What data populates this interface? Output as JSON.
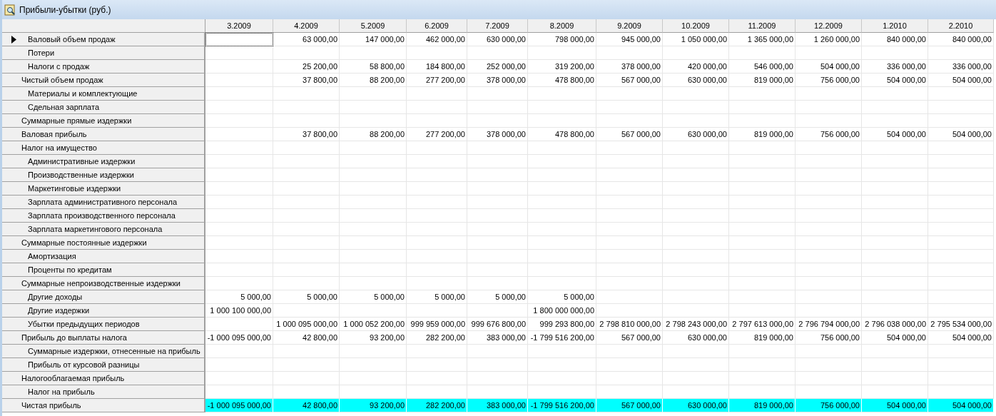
{
  "window": {
    "title": "Прибыли-убытки (руб.)"
  },
  "table": {
    "columns": [
      "3.2009",
      "4.2009",
      "5.2009",
      "6.2009",
      "7.2009",
      "8.2009",
      "9.2009",
      "10.2009",
      "11.2009",
      "12.2009",
      "1.2010",
      "2.2010"
    ],
    "rows": [
      {
        "label": "Валовый объем продаж",
        "kind": "item",
        "current": true,
        "highlighted": false,
        "cells": [
          null,
          "63 000,00",
          "147 000,00",
          "462 000,00",
          "630 000,00",
          "798 000,00",
          "945 000,00",
          "1 050 000,00",
          "1 365 000,00",
          "1 260 000,00",
          "840 000,00",
          "840 000,00"
        ]
      },
      {
        "label": "Потери",
        "kind": "item",
        "current": false,
        "highlighted": false,
        "cells": [
          null,
          null,
          null,
          null,
          null,
          null,
          null,
          null,
          null,
          null,
          null,
          null
        ]
      },
      {
        "label": "Налоги с продаж",
        "kind": "item",
        "current": false,
        "highlighted": false,
        "cells": [
          null,
          "25 200,00",
          "58 800,00",
          "184 800,00",
          "252 000,00",
          "319 200,00",
          "378 000,00",
          "420 000,00",
          "546 000,00",
          "504 000,00",
          "336 000,00",
          "336 000,00"
        ]
      },
      {
        "label": "Чистый объем продаж",
        "kind": "total",
        "current": false,
        "highlighted": false,
        "cells": [
          null,
          "37 800,00",
          "88 200,00",
          "277 200,00",
          "378 000,00",
          "478 800,00",
          "567 000,00",
          "630 000,00",
          "819 000,00",
          "756 000,00",
          "504 000,00",
          "504 000,00"
        ]
      },
      {
        "label": "Материалы и комплектующие",
        "kind": "item",
        "current": false,
        "highlighted": false,
        "cells": [
          null,
          null,
          null,
          null,
          null,
          null,
          null,
          null,
          null,
          null,
          null,
          null
        ]
      },
      {
        "label": "Сдельная зарплата",
        "kind": "item",
        "current": false,
        "highlighted": false,
        "cells": [
          null,
          null,
          null,
          null,
          null,
          null,
          null,
          null,
          null,
          null,
          null,
          null
        ]
      },
      {
        "label": "Суммарные прямые издержки",
        "kind": "total",
        "current": false,
        "highlighted": false,
        "cells": [
          null,
          null,
          null,
          null,
          null,
          null,
          null,
          null,
          null,
          null,
          null,
          null
        ]
      },
      {
        "label": "Валовая прибыль",
        "kind": "total",
        "current": false,
        "highlighted": false,
        "cells": [
          null,
          "37 800,00",
          "88 200,00",
          "277 200,00",
          "378 000,00",
          "478 800,00",
          "567 000,00",
          "630 000,00",
          "819 000,00",
          "756 000,00",
          "504 000,00",
          "504 000,00"
        ]
      },
      {
        "label": "Налог на имущество",
        "kind": "total",
        "current": false,
        "highlighted": false,
        "cells": [
          null,
          null,
          null,
          null,
          null,
          null,
          null,
          null,
          null,
          null,
          null,
          null
        ]
      },
      {
        "label": "Административные издержки",
        "kind": "item",
        "current": false,
        "highlighted": false,
        "cells": [
          null,
          null,
          null,
          null,
          null,
          null,
          null,
          null,
          null,
          null,
          null,
          null
        ]
      },
      {
        "label": "Производственные издержки",
        "kind": "item",
        "current": false,
        "highlighted": false,
        "cells": [
          null,
          null,
          null,
          null,
          null,
          null,
          null,
          null,
          null,
          null,
          null,
          null
        ]
      },
      {
        "label": "Маркетинговые издержки",
        "kind": "item",
        "current": false,
        "highlighted": false,
        "cells": [
          null,
          null,
          null,
          null,
          null,
          null,
          null,
          null,
          null,
          null,
          null,
          null
        ]
      },
      {
        "label": "Зарплата административного персонала",
        "kind": "item",
        "current": false,
        "highlighted": false,
        "cells": [
          null,
          null,
          null,
          null,
          null,
          null,
          null,
          null,
          null,
          null,
          null,
          null
        ]
      },
      {
        "label": "Зарплата производственного персонала",
        "kind": "item",
        "current": false,
        "highlighted": false,
        "cells": [
          null,
          null,
          null,
          null,
          null,
          null,
          null,
          null,
          null,
          null,
          null,
          null
        ]
      },
      {
        "label": "Зарплата маркетингового персонала",
        "kind": "item",
        "current": false,
        "highlighted": false,
        "cells": [
          null,
          null,
          null,
          null,
          null,
          null,
          null,
          null,
          null,
          null,
          null,
          null
        ]
      },
      {
        "label": "Суммарные постоянные издержки",
        "kind": "total",
        "current": false,
        "highlighted": false,
        "cells": [
          null,
          null,
          null,
          null,
          null,
          null,
          null,
          null,
          null,
          null,
          null,
          null
        ]
      },
      {
        "label": "Амортизация",
        "kind": "item",
        "current": false,
        "highlighted": false,
        "cells": [
          null,
          null,
          null,
          null,
          null,
          null,
          null,
          null,
          null,
          null,
          null,
          null
        ]
      },
      {
        "label": "Проценты по кредитам",
        "kind": "item",
        "current": false,
        "highlighted": false,
        "cells": [
          null,
          null,
          null,
          null,
          null,
          null,
          null,
          null,
          null,
          null,
          null,
          null
        ]
      },
      {
        "label": "Суммарные непроизводственные издержки",
        "kind": "total",
        "current": false,
        "highlighted": false,
        "cells": [
          null,
          null,
          null,
          null,
          null,
          null,
          null,
          null,
          null,
          null,
          null,
          null
        ]
      },
      {
        "label": "Другие доходы",
        "kind": "item",
        "current": false,
        "highlighted": false,
        "cells": [
          "5 000,00",
          "5 000,00",
          "5 000,00",
          "5 000,00",
          "5 000,00",
          "5 000,00",
          null,
          null,
          null,
          null,
          null,
          null
        ]
      },
      {
        "label": "Другие издержки",
        "kind": "item",
        "current": false,
        "highlighted": false,
        "cells": [
          "1 000 100 000,00",
          null,
          null,
          null,
          null,
          "1 800 000 000,00",
          null,
          null,
          null,
          null,
          null,
          null
        ]
      },
      {
        "label": "Убытки предыдущих периодов",
        "kind": "item",
        "current": false,
        "highlighted": false,
        "cells": [
          null,
          "1 000 095 000,00",
          "1 000 052 200,00",
          "999 959 000,00",
          "999 676 800,00",
          "999 293 800,00",
          "2 798 810 000,00",
          "2 798 243 000,00",
          "2 797 613 000,00",
          "2 796 794 000,00",
          "2 796 038 000,00",
          "2 795 534 000,00"
        ]
      },
      {
        "label": "Прибыль до выплаты налога",
        "kind": "total",
        "current": false,
        "highlighted": false,
        "cells": [
          "-1 000 095 000,00",
          "42 800,00",
          "93 200,00",
          "282 200,00",
          "383 000,00",
          "-1 799 516 200,00",
          "567 000,00",
          "630 000,00",
          "819 000,00",
          "756 000,00",
          "504 000,00",
          "504 000,00"
        ]
      },
      {
        "label": "Суммарные издержки, отнесенные на прибыль",
        "kind": "item",
        "current": false,
        "highlighted": false,
        "cells": [
          null,
          null,
          null,
          null,
          null,
          null,
          null,
          null,
          null,
          null,
          null,
          null
        ]
      },
      {
        "label": "Прибыль от курсовой разницы",
        "kind": "item",
        "current": false,
        "highlighted": false,
        "cells": [
          null,
          null,
          null,
          null,
          null,
          null,
          null,
          null,
          null,
          null,
          null,
          null
        ]
      },
      {
        "label": "Налогооблагаемая прибыль",
        "kind": "total",
        "current": false,
        "highlighted": false,
        "cells": [
          null,
          null,
          null,
          null,
          null,
          null,
          null,
          null,
          null,
          null,
          null,
          null
        ]
      },
      {
        "label": "Налог на прибыль",
        "kind": "item",
        "current": false,
        "highlighted": false,
        "cells": [
          null,
          null,
          null,
          null,
          null,
          null,
          null,
          null,
          null,
          null,
          null,
          null
        ]
      },
      {
        "label": "Чистая прибыль",
        "kind": "total",
        "current": false,
        "highlighted": true,
        "cells": [
          "-1 000 095 000,00",
          "42 800,00",
          "93 200,00",
          "282 200,00",
          "383 000,00",
          "-1 799 516 200,00",
          "567 000,00",
          "630 000,00",
          "819 000,00",
          "756 000,00",
          "504 000,00",
          "504 000,00"
        ]
      }
    ]
  }
}
